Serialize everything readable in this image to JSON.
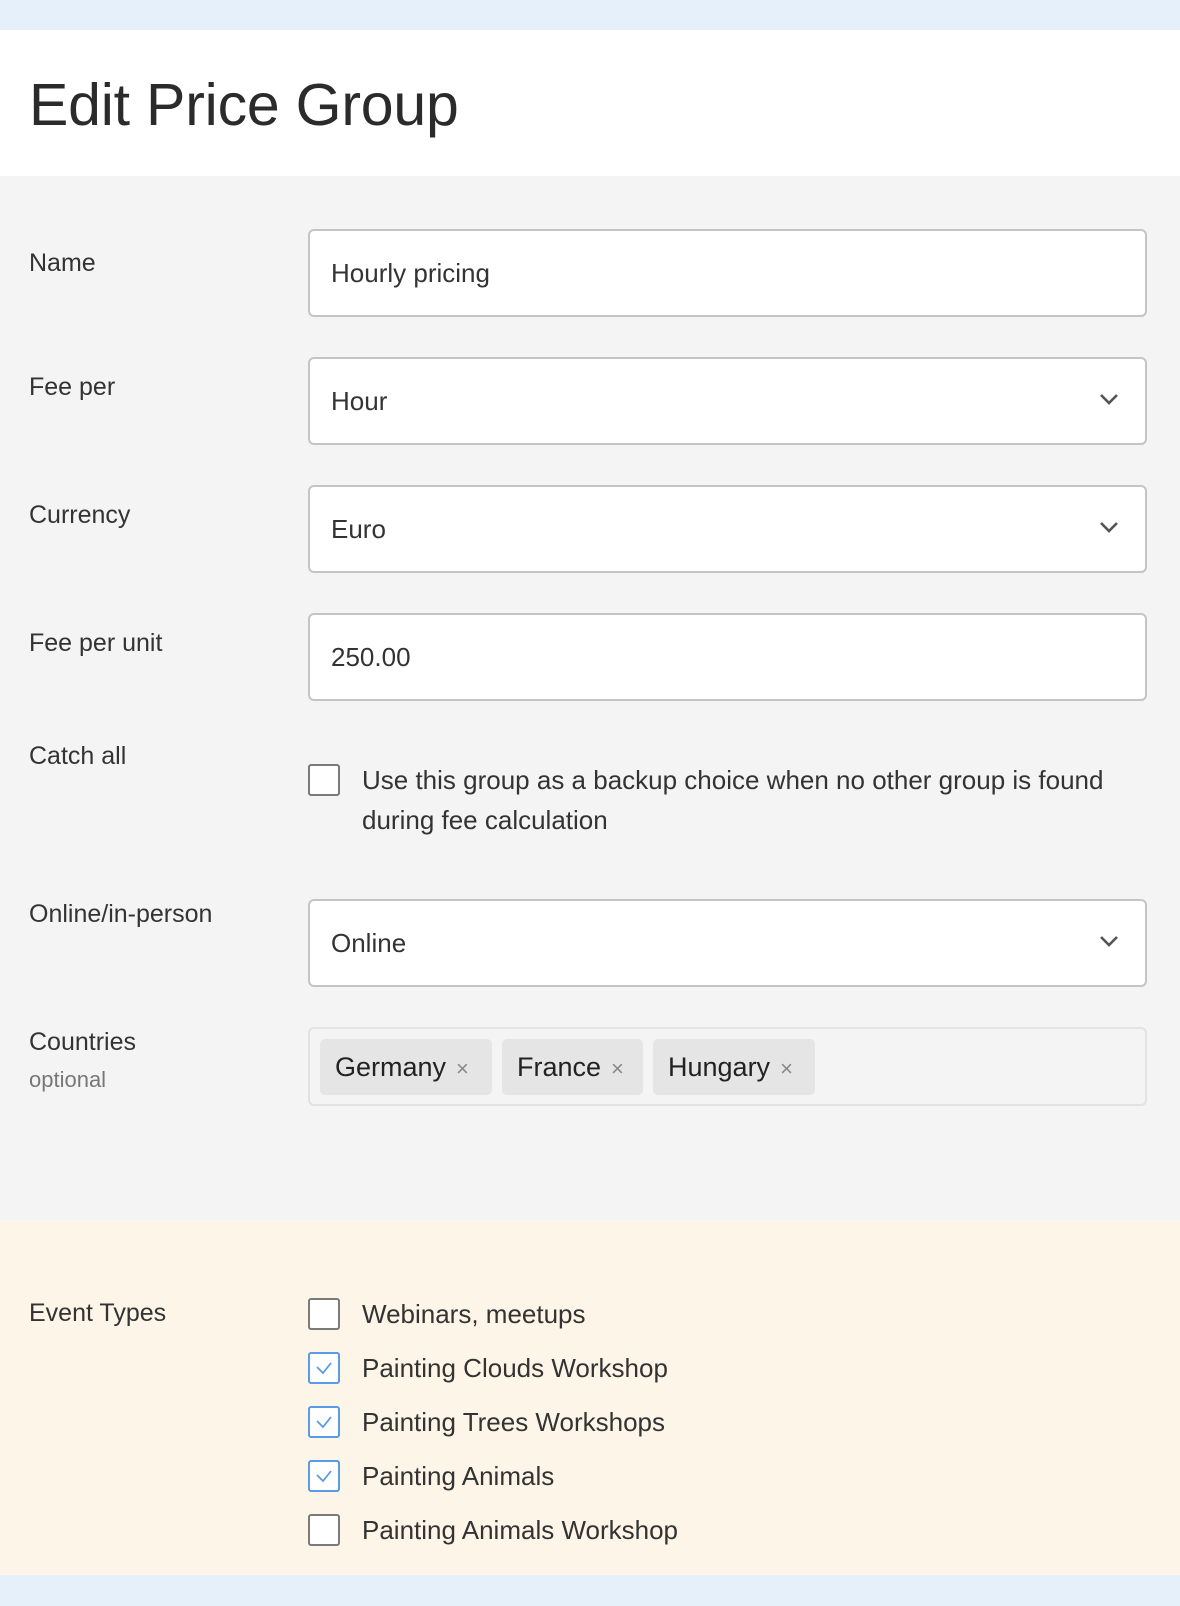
{
  "page": {
    "title": "Edit Price Group"
  },
  "form": {
    "name": {
      "label": "Name",
      "value": "Hourly pricing"
    },
    "fee_per": {
      "label": "Fee per",
      "value": "Hour"
    },
    "currency": {
      "label": "Currency",
      "value": "Euro"
    },
    "fee_per_unit": {
      "label": "Fee per unit",
      "value": "250.00"
    },
    "catch_all": {
      "label": "Catch all",
      "checked": false,
      "text": "Use this group as a backup choice when no other group is found during fee calculation"
    },
    "online_in_person": {
      "label": "Online/in-person",
      "value": "Online"
    },
    "countries": {
      "label": "Countries",
      "sublabel": "optional",
      "tags": [
        {
          "label": "Germany",
          "remove": "×"
        },
        {
          "label": "France",
          "remove": "×"
        },
        {
          "label": "Hungary",
          "remove": "×"
        }
      ]
    }
  },
  "event_types": {
    "label": "Event Types",
    "items": [
      {
        "label": "Webinars, meetups",
        "checked": false
      },
      {
        "label": "Painting Clouds Workshop",
        "checked": true
      },
      {
        "label": "Painting Trees Workshops",
        "checked": true
      },
      {
        "label": "Painting Animals",
        "checked": true
      },
      {
        "label": "Painting Animals Workshop",
        "checked": false
      }
    ]
  },
  "colors": {
    "accent": "#5a9be6",
    "top_band": "#e6f0fa",
    "main_bg": "#f4f4f4",
    "events_bg": "#fdf5e8"
  }
}
